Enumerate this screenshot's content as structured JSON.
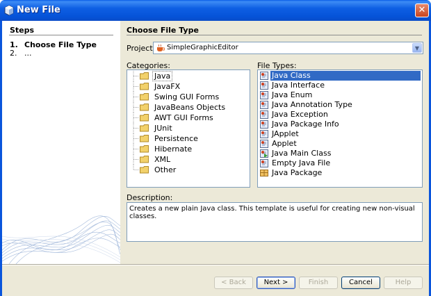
{
  "window": {
    "title": "New File",
    "close_label": "✕"
  },
  "steps": {
    "title": "Steps",
    "items": [
      {
        "num": "1.",
        "label": "Choose File Type"
      },
      {
        "num": "2.",
        "label": "..."
      }
    ]
  },
  "main": {
    "title": "Choose File Type",
    "project_label": "Project:",
    "project_value": "SimpleGraphicEditor",
    "categories_label": "Categories:",
    "categories": [
      "Java",
      "JavaFX",
      "Swing GUI Forms",
      "JavaBeans Objects",
      "AWT GUI Forms",
      "JUnit",
      "Persistence",
      "Hibernate",
      "XML",
      "Other"
    ],
    "selected_category": "Java",
    "file_types_label": "File Types:",
    "file_types": [
      {
        "label": "Java Class",
        "icon": "java-class-icon"
      },
      {
        "label": "Java Interface",
        "icon": "java-class-icon"
      },
      {
        "label": "Java Enum",
        "icon": "java-class-icon"
      },
      {
        "label": "Java Annotation Type",
        "icon": "java-class-icon"
      },
      {
        "label": "Java Exception",
        "icon": "java-class-icon"
      },
      {
        "label": "Java Package Info",
        "icon": "java-class-icon"
      },
      {
        "label": "JApplet",
        "icon": "java-class-icon"
      },
      {
        "label": "Applet",
        "icon": "java-class-icon"
      },
      {
        "label": "Java Main Class",
        "icon": "java-main-class-icon"
      },
      {
        "label": "Empty Java File",
        "icon": "java-class-icon"
      },
      {
        "label": "Java Package",
        "icon": "package-icon"
      }
    ],
    "selected_file_type": "Java Class",
    "description_label": "Description:",
    "description": "Creates a new plain Java class. This template is useful for creating new non-visual classes."
  },
  "buttons": {
    "back": "< Back",
    "next": "Next >",
    "finish": "Finish",
    "cancel": "Cancel",
    "help": "Help"
  },
  "colors": {
    "titlebar": "#0553d8",
    "selection": "#316ac5",
    "dialog_bg": "#ece9d8",
    "folder": "#f2d16b"
  }
}
